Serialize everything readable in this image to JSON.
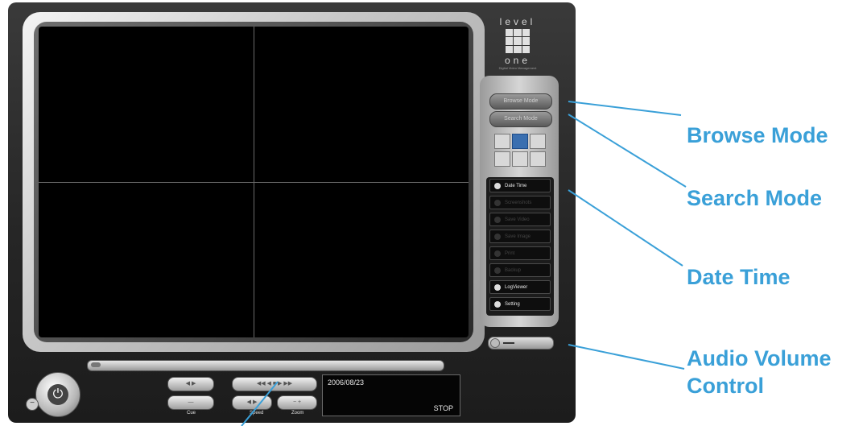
{
  "brand": {
    "top": "level",
    "bottom": "one",
    "tagline": "Digital Video Management"
  },
  "modes": {
    "browse": "Browse Mode",
    "search": "Search Mode"
  },
  "menu": [
    {
      "label": "Date Time",
      "enabled": true,
      "icon": "clock-icon"
    },
    {
      "label": "Screenshots",
      "enabled": false,
      "icon": "camera-icon"
    },
    {
      "label": "Save Video",
      "enabled": false,
      "icon": "save-video-icon"
    },
    {
      "label": "Save Image",
      "enabled": false,
      "icon": "save-image-icon"
    },
    {
      "label": "Print",
      "enabled": false,
      "icon": "print-icon"
    },
    {
      "label": "Backup",
      "enabled": false,
      "icon": "backup-icon"
    },
    {
      "label": "LogViewer",
      "enabled": true,
      "icon": "eye-icon"
    },
    {
      "label": "Setting",
      "enabled": true,
      "icon": "wrench-icon"
    }
  ],
  "controls": {
    "cue_label": "Cue",
    "speed_label": "Speed",
    "zoom_label": "Zoom"
  },
  "status": {
    "date": "2006/08/23",
    "state": "STOP"
  },
  "callouts": {
    "browse_mode": "Browse Mode",
    "search_mode": "Search Mode",
    "date_time": "Date Time",
    "audio_volume_line1": "Audio Volume",
    "audio_volume_line2": "Control"
  },
  "colors": {
    "callout": "#3aa0d8",
    "selected_layout": "#3a6fb0"
  }
}
